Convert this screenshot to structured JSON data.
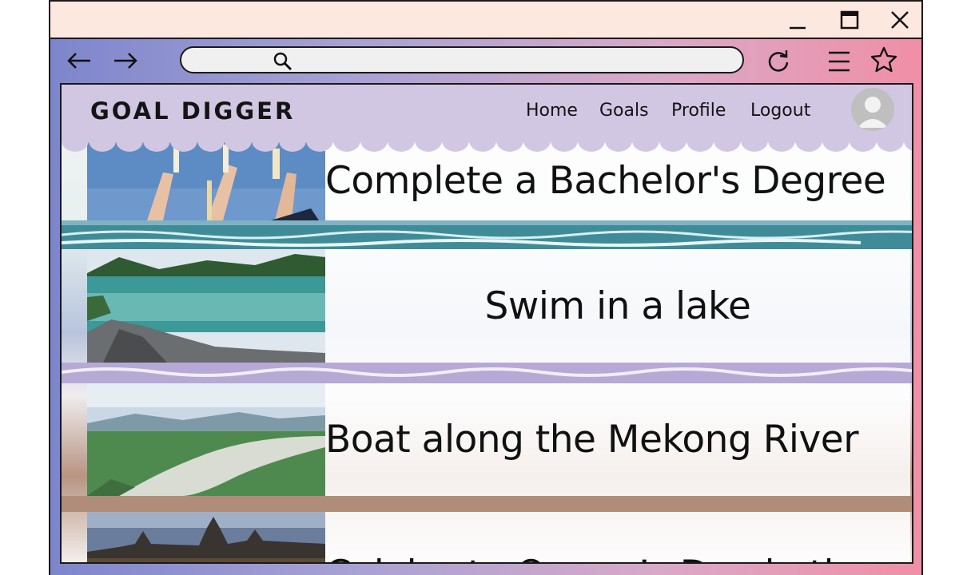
{
  "browser": {
    "window_controls": {
      "minimize": "minimize-icon",
      "maximize": "maximize-icon",
      "close": "close-icon"
    },
    "toolbar": {
      "back": "arrow-left-icon",
      "forward": "arrow-right-icon",
      "reload": "reload-icon",
      "menu": "hamburger-menu-icon",
      "bookmark": "star-icon"
    },
    "address_bar": {
      "value": "",
      "placeholder": "",
      "icon": "search-icon"
    }
  },
  "site": {
    "logo": "GOAL DIGGER",
    "nav": [
      "Home",
      "Goals",
      "Profile",
      "Logout"
    ],
    "avatar": "user-avatar-icon",
    "colors": {
      "header": "#d2c7e3",
      "frame_gradient_left": "#7d86cc",
      "frame_gradient_right": "#f08fa6",
      "titlebar": "#fde8e0"
    }
  },
  "goals": [
    {
      "title": "Complete a Bachelor's Degree",
      "image": "graduates-holding-diplomas"
    },
    {
      "title": "Swim in a lake",
      "image": "mountain-lake"
    },
    {
      "title": "Boat along the Mekong River",
      "image": "mekong-river-valley"
    },
    {
      "title": "Celebrate Queen’s Day in the",
      "image": "amsterdam-skyline"
    }
  ]
}
